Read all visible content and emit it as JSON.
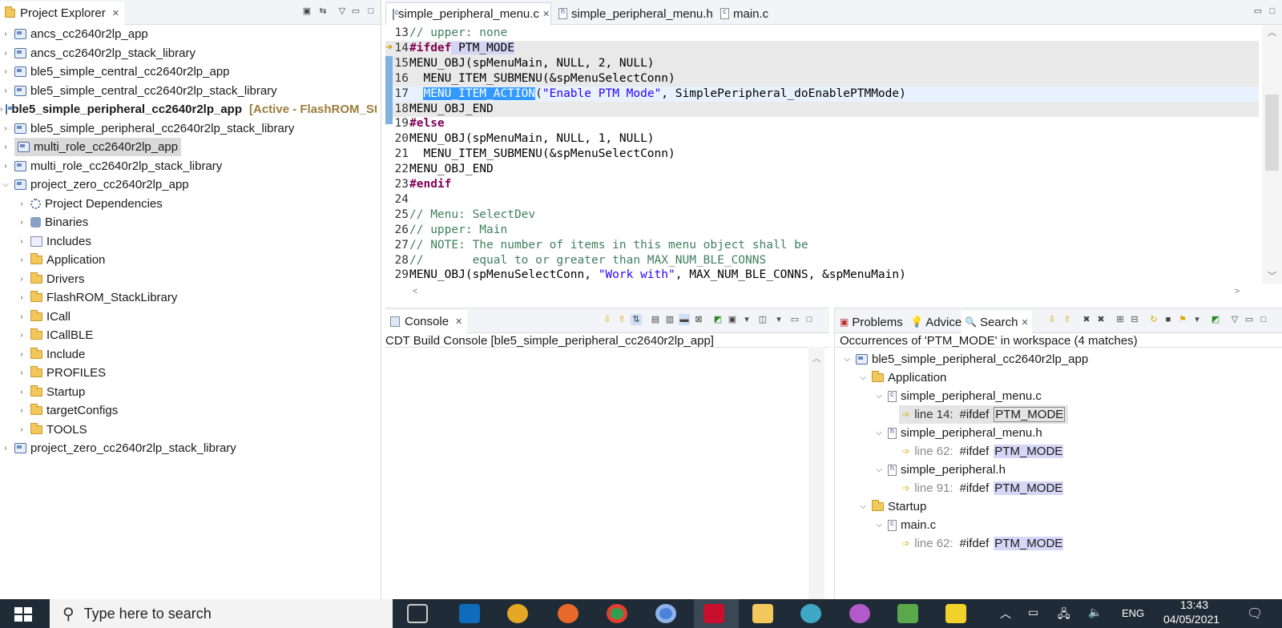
{
  "project_explorer": {
    "title": "Project Explorer",
    "items": [
      {
        "label": "ancs_cc2640r2lp_app",
        "icon": "project-icon",
        "expanded": false
      },
      {
        "label": "ancs_cc2640r2lp_stack_library",
        "icon": "project-icon",
        "expanded": false
      },
      {
        "label": "ble5_simple_central_cc2640r2lp_app",
        "icon": "project-icon",
        "expanded": false
      },
      {
        "label": "ble5_simple_central_cc2640r2lp_stack_library",
        "icon": "project-icon",
        "expanded": false
      },
      {
        "label": "ble5_simple_peripheral_cc2640r2lp_app",
        "icon": "project-icon",
        "expanded": false,
        "active_tag": "[Active - FlashROM_St"
      },
      {
        "label": "ble5_simple_peripheral_cc2640r2lp_stack_library",
        "icon": "project-icon",
        "expanded": false
      },
      {
        "label": "multi_role_cc2640r2lp_app",
        "icon": "project-icon",
        "expanded": false,
        "selected": true
      },
      {
        "label": "multi_role_cc2640r2lp_stack_library",
        "icon": "project-icon",
        "expanded": false
      },
      {
        "label": "project_zero_cc2640r2lp_app",
        "icon": "project-icon",
        "expanded": true
      },
      {
        "label": "Project Dependencies",
        "icon": "gear-icon",
        "child": true
      },
      {
        "label": "Binaries",
        "icon": "binaries-icon",
        "child": true
      },
      {
        "label": "Includes",
        "icon": "includes-icon",
        "child": true
      },
      {
        "label": "Application",
        "icon": "folder-icon",
        "child": true
      },
      {
        "label": "Drivers",
        "icon": "folder-icon",
        "child": true
      },
      {
        "label": "FlashROM_StackLibrary",
        "icon": "folder-icon",
        "child": true
      },
      {
        "label": "ICall",
        "icon": "folder-icon",
        "child": true
      },
      {
        "label": "ICallBLE",
        "icon": "folder-icon",
        "child": true
      },
      {
        "label": "Include",
        "icon": "folder-icon",
        "child": true
      },
      {
        "label": "PROFILES",
        "icon": "folder-icon",
        "child": true
      },
      {
        "label": "Startup",
        "icon": "folder-icon",
        "child": true
      },
      {
        "label": "targetConfigs",
        "icon": "folder-icon",
        "child": true
      },
      {
        "label": "TOOLS",
        "icon": "folder-icon",
        "child": true
      },
      {
        "label": "project_zero_cc2640r2lp_stack_library",
        "icon": "project-icon",
        "expanded": false
      }
    ]
  },
  "editor": {
    "tabs": [
      {
        "label": "simple_peripheral_menu.c",
        "selected": true
      },
      {
        "label": "simple_peripheral_menu.h",
        "selected": false
      },
      {
        "label": "main.c",
        "selected": false
      }
    ],
    "lines": [
      {
        "no": "13",
        "text": "// upper: none"
      },
      {
        "no": "14",
        "kw": "#ifdef",
        "rest": " PTM_MODE"
      },
      {
        "no": "15",
        "text": "MENU_OBJ(spMenuMain, NULL, 2, NULL)"
      },
      {
        "no": "16",
        "text": "  MENU_ITEM_SUBMENU(&spMenuSelectConn)"
      },
      {
        "no": "17",
        "sel": "MENU_ITEM_ACTION",
        "str": "\"Enable PTM Mode\"",
        "rest": ", SimplePeripheral_doEnablePTMMode)"
      },
      {
        "no": "18",
        "text": "MENU_OBJ_END"
      },
      {
        "no": "19",
        "kw": "#else",
        "rest": ""
      },
      {
        "no": "20",
        "text": "MENU_OBJ(spMenuMain, NULL, 1, NULL)"
      },
      {
        "no": "21",
        "text": "  MENU_ITEM_SUBMENU(&spMenuSelectConn)"
      },
      {
        "no": "22",
        "text": "MENU_OBJ_END"
      },
      {
        "no": "23",
        "kw": "#endif",
        "rest": ""
      },
      {
        "no": "24",
        "text": ""
      },
      {
        "no": "25",
        "text": "// Menu: SelectDev"
      },
      {
        "no": "26",
        "text": "// upper: Main"
      },
      {
        "no": "27",
        "text": "// NOTE: The number of items in this menu object shall be"
      },
      {
        "no": "28",
        "text": "//       equal to or greater than MAX_NUM_BLE_CONNS"
      },
      {
        "no": "29",
        "pre": "MENU_OBJ(spMenuSelectConn, ",
        "str": "\"Work with\"",
        "rest": ", MAX_NUM_BLE_CONNS, &spMenuMain)"
      }
    ]
  },
  "console": {
    "tab_label": "Console",
    "title": "CDT Build Console [ble5_simple_peripheral_cc2640r2lp_app]"
  },
  "search_view": {
    "tabs": [
      "Problems",
      "Advice",
      "Search"
    ],
    "summary": "Occurrences of 'PTM_MODE' in workspace (4 matches)",
    "project": "ble5_simple_peripheral_cc2640r2lp_app",
    "folder_application": "Application",
    "file1": "simple_peripheral_menu.c",
    "file2": "simple_peripheral_menu.h",
    "file3": "simple_peripheral.h",
    "folder_startup": "Startup",
    "file4": "main.c",
    "match1_line": "line 14:",
    "match2_line": "line 62:",
    "match3_line": "line 91:",
    "match4_line": "line 62:",
    "match_prefix": "#ifdef",
    "match_term": "PTM_MODE"
  },
  "taskbar": {
    "search_placeholder": "Type here to search",
    "language": "ENG",
    "time": "13:43",
    "date": "04/05/2021"
  },
  "colors": {
    "keyword": "#7f0055",
    "string": "#2a00ff",
    "comment": "#3f7f5f",
    "selection": "#3399ff",
    "taskbar": "#1f2b36"
  }
}
